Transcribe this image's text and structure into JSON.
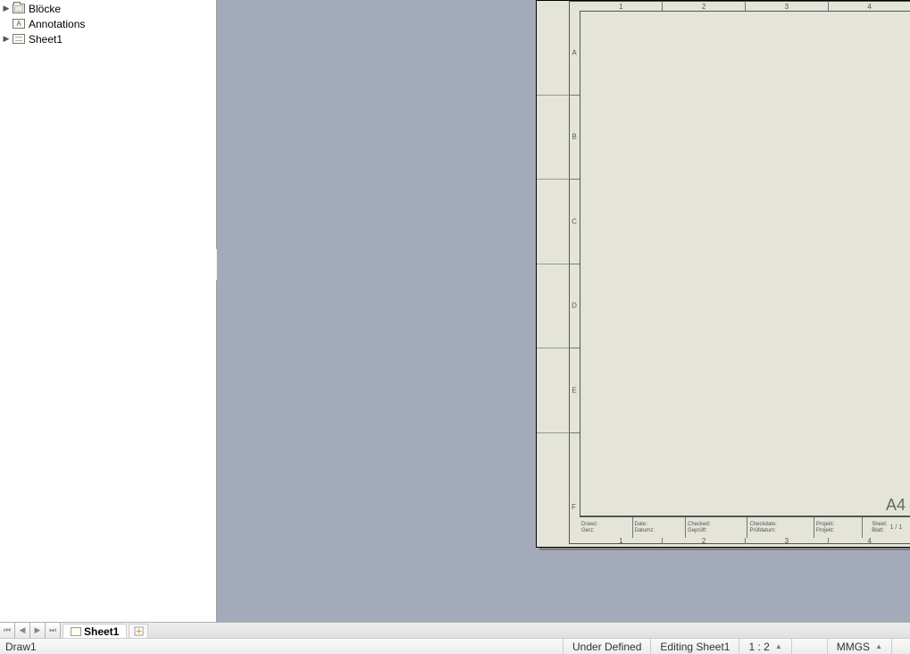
{
  "tree": {
    "items": [
      {
        "label": "Blöcke",
        "icon": "folder",
        "expander": true
      },
      {
        "label": "Annotations",
        "icon": "annotation",
        "expander": false
      },
      {
        "label": "Sheet1",
        "icon": "sheet",
        "expander": true
      }
    ]
  },
  "sheet": {
    "cols": [
      "1",
      "2",
      "3",
      "4"
    ],
    "rows": [
      "A",
      "B",
      "C",
      "D",
      "E",
      "F"
    ],
    "size_label": "A4",
    "title_block": {
      "c0a": "Drawz:",
      "c0b": "Gerz:",
      "c1a": "Date:",
      "c1b": "Datumz:",
      "c2a": "Checked:",
      "c2b": "Geprüft:",
      "c3a": "Checkdate:",
      "c3b": "Prüfdatum:",
      "c4a": "Projekt:",
      "c4b": "Projekt:",
      "c5a": "Sheet:",
      "c5b": "Blatt:",
      "c5v": "1 / 1"
    }
  },
  "tabs": {
    "sheet_label": "Sheet1"
  },
  "status": {
    "doc": "Draw1",
    "state": "Under Defined",
    "mode": "Editing Sheet1",
    "scale": "1 : 2",
    "units": "MMGS"
  }
}
